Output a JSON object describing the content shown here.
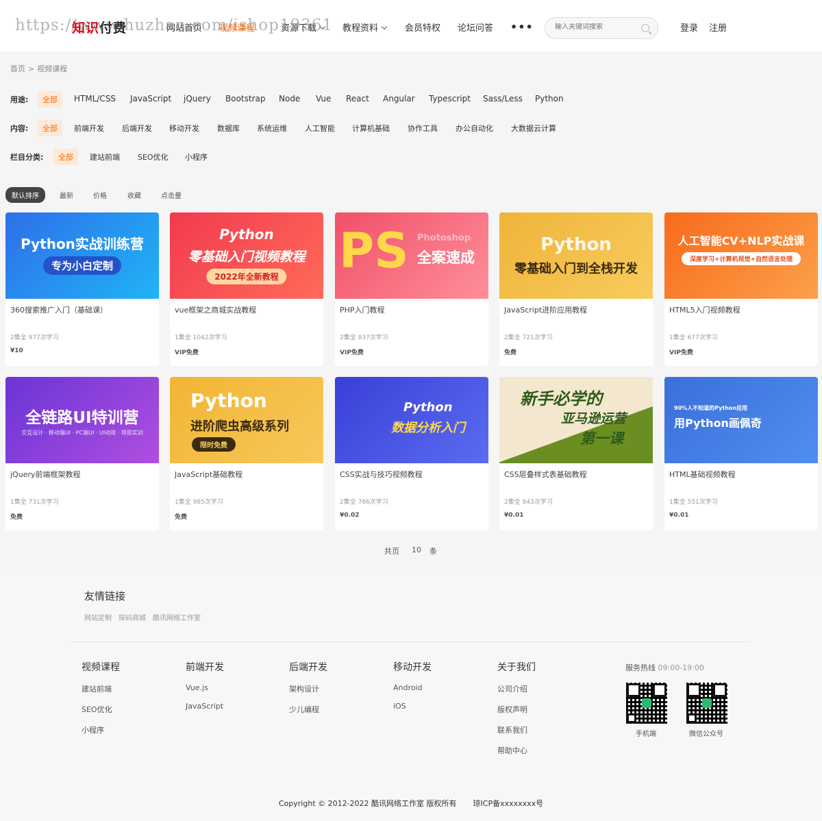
{
  "header": {
    "logo_red": "知识",
    "logo_dark": "付费",
    "watermark": "https://www.huzhan.com/ishop19361",
    "nav": [
      {
        "label": "网站首页",
        "active": false
      },
      {
        "label": "视频课程",
        "active": true
      },
      {
        "label": "资源下载",
        "active": false
      },
      {
        "label": "教程资料",
        "active": false
      },
      {
        "label": "会员特权",
        "active": false
      },
      {
        "label": "论坛问答",
        "active": false
      }
    ],
    "more": "•••",
    "search_placeholder": "输入关键词搜索",
    "login": "登录",
    "register": "注册"
  },
  "breadcrumb": {
    "home": "首页",
    "sep": ">",
    "current": "视频课程"
  },
  "filters": {
    "usage": {
      "label": "用途:",
      "options": [
        "全部",
        "HTML/CSS",
        "JavaScript",
        "jQuery",
        "Bootstrap",
        "Node",
        "Vue",
        "React",
        "Angular",
        "Typescript",
        "Sass/Less",
        "Python"
      ]
    },
    "content": {
      "label": "内容:",
      "options": [
        "全部",
        "前端开发",
        "后端开发",
        "移动开发",
        "数据库",
        "系统运维",
        "人工智能",
        "计算机基础",
        "协作工具",
        "办公自动化",
        "大数据云计算"
      ]
    },
    "category": {
      "label": "栏目分类:",
      "options": [
        "全部",
        "建站前端",
        "SEO优化",
        "小程序"
      ]
    }
  },
  "sort": [
    "默认排序",
    "最新",
    "价格",
    "收藏",
    "点击量"
  ],
  "cards": [
    {
      "title": "360搜索推广入门（基础课）",
      "meta": "2集全 977次学习",
      "price": "¥10",
      "thumb_title": "Python实战训练营",
      "thumb_sub": "专为小白定制",
      "bg": "#2f6fea",
      "bg2": "#1fb4f5",
      "pill_bg": "#2452c9",
      "pill_fg": "#ffffff"
    },
    {
      "title": "vue框架之商城实战教程",
      "meta": "1集全 1042次学习",
      "price": "VIP免费",
      "thumb_top": "Python",
      "thumb_title": "零基础入门视频教程",
      "thumb_sub": "2022年全新教程",
      "bg": "#f23a4e",
      "bg2": "#ff6b5a",
      "pill_bg": "#ffd8a0",
      "pill_fg": "#d21f2f"
    },
    {
      "title": "PHP入门教程",
      "meta": "2集全 837次学习",
      "price": "VIP免费",
      "thumb_big": "PS",
      "thumb_title": "全案速成",
      "thumb_sub": "Photoshop",
      "bg": "#f0506a",
      "bg2": "#ff8f9a"
    },
    {
      "title": "JavaScript进阶应用教程",
      "meta": "2集全 721次学习",
      "price": "免费",
      "thumb_top": "Python",
      "thumb_title": "零基础入门到全栈开发",
      "bg": "#f0b43a",
      "bg2": "#f7cc5e"
    },
    {
      "title": "HTML5入门视频教程",
      "meta": "1集全 677次学习",
      "price": "VIP免费",
      "thumb_title": "人工智能CV+NLP实战课",
      "thumb_sub": "深度学习+计算机视觉+自然语言处理",
      "bg": "#f76b1c",
      "bg2": "#fca04a",
      "pill_bg": "#ffffff",
      "pill_fg": "#e8501a"
    },
    {
      "title": "jQuery前端框架教程",
      "meta": "1集全 731次学习",
      "price": "免费",
      "thumb_title": "全链路UI特训营",
      "thumb_sub": "交互设计 · 移动端UI · PC端UI · UI动效 · 项目实训",
      "bg": "#6a34d6",
      "bg2": "#b04fe0"
    },
    {
      "title": "JavaScript基础教程",
      "meta": "1集全 985次学习",
      "price": "免费",
      "thumb_top": "Python",
      "thumb_title": "进阶爬虫高级系列",
      "thumb_sub": "限时免费",
      "bg": "#f2b534",
      "bg2": "#f6c85a",
      "pill_bg": "#3a2a10",
      "pill_fg": "#f6c85a"
    },
    {
      "title": "CSS实战与技巧视频教程",
      "meta": "2集全 766次学习",
      "price": "¥0.02",
      "thumb_top": "Python",
      "thumb_title": "数据分析入门",
      "bg": "#3a3fd8",
      "bg2": "#5a6cf0"
    },
    {
      "title": "CSS层叠样式表基础教程",
      "meta": "2集全 843次学习",
      "price": "¥0.01",
      "thumb_top": "新手必学的",
      "thumb_title": "亚马逊运营",
      "thumb_sub": "第一课",
      "bg": "#f3e7cf",
      "bg2": "#6b8e23"
    },
    {
      "title": "HTML基础视频教程",
      "meta": "1集全 551次学习",
      "price": "¥0.01",
      "thumb_top": "90%人不知道的Python应用",
      "thumb_title": "用Python画佩奇",
      "bg": "#3b6fd9",
      "bg2": "#4f8ff0"
    }
  ],
  "pagination": {
    "prefix": "共页",
    "count": "10",
    "suffix": "条"
  },
  "footer": {
    "links_title": "友情链接",
    "links": [
      "网站定制",
      "探码商城",
      "酷讯网络工作室"
    ],
    "columns": [
      {
        "heading": "视频课程",
        "items": [
          "建站前端",
          "SEO优化",
          "小程序"
        ]
      },
      {
        "heading": "前端开发",
        "items": [
          "Vue.js",
          "JavaScript"
        ]
      },
      {
        "heading": "后端开发",
        "items": [
          "架构设计",
          "少儿编程"
        ]
      },
      {
        "heading": "移动开发",
        "items": [
          "Android",
          "iOS"
        ]
      },
      {
        "heading": "关于我们",
        "items": [
          "公司介绍",
          "版权声明",
          "联系我们",
          "帮助中心"
        ]
      }
    ],
    "hotline_label": "服务热线",
    "hotline_time": "09:00-19:00",
    "qr1_label": "手机端",
    "qr2_label": "微信公众号",
    "copyright": "Copyright © 2012-2022 酷讯网络工作室 版权所有",
    "icp": "琼ICP备xxxxxxxx号"
  },
  "colors": {
    "accent": "#ff6a00",
    "accent_bg": "#fde9d9"
  }
}
